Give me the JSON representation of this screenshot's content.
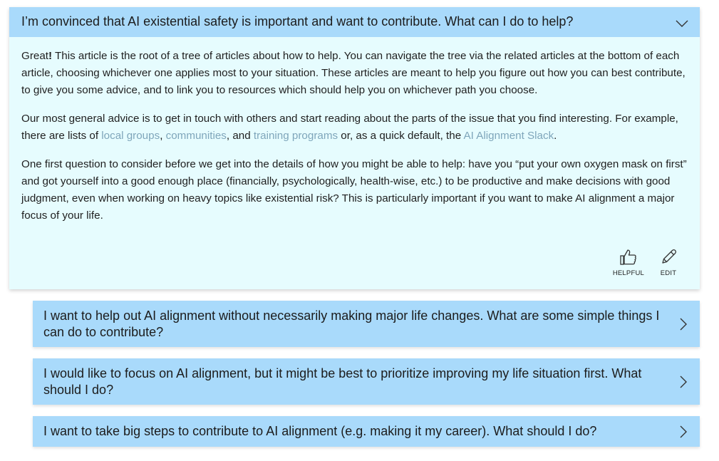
{
  "main": {
    "question": "I’m convinced that AI existential safety is important and want to contribute. What can I do to help?",
    "paragraphs": [
      {
        "segments": [
          {
            "text": "Great"
          },
          {
            "text": "!",
            "bold": true
          },
          {
            "text": " This article is the root of a tree of articles about how to help. You can navigate the tree via the related articles at the bottom of each article, choosing whichever one applies most to your situation. These articles are meant to help you figure out how you can best contribute, to give you some advice, and to link you to resources which should help you on whichever path you choose."
          }
        ]
      },
      {
        "segments": [
          {
            "text": "Our most general advice is to get in touch with others and start reading about the parts of the issue that you find interesting. For example, there are lists of "
          },
          {
            "text": "local groups",
            "link": true
          },
          {
            "text": ", "
          },
          {
            "text": "communities",
            "link": true
          },
          {
            "text": ", and "
          },
          {
            "text": "training programs",
            "link": true
          },
          {
            "text": " or, as a quick default, the "
          },
          {
            "text": "AI Alignment Slack",
            "link": true
          },
          {
            "text": "."
          }
        ]
      },
      {
        "segments": [
          {
            "text": "One first question to consider before we get into the details of how you might be able to help: have you “put your own oxygen mask on first” and got yourself into a good enough place (financially, psychologically, health-wise, etc.) to be productive and make decisions with good judgment, even when working on heavy topics like existential risk? This is particularly important if you want to make AI alignment a major focus of your life."
          }
        ]
      }
    ],
    "actions": {
      "helpful_label": "HELPFUL",
      "edit_label": "EDIT"
    },
    "header_icon": "chevron-down-icon"
  },
  "related": [
    {
      "question": "I want to help out AI alignment without necessarily making major life changes. What are some simple things I can do to contribute?",
      "icon": "chevron-right-icon"
    },
    {
      "question": "I would like to focus on AI alignment, but it might be best to prioritize improving my life situation first. What should I do?",
      "icon": "chevron-right-icon"
    },
    {
      "question": "I want to take big steps to contribute to AI alignment (e.g. making it my career). What should I do?",
      "icon": "chevron-right-icon"
    }
  ],
  "colors": {
    "header_bg": "#a9dafb",
    "card_bg": "#e6fcfe",
    "link": "#7fa6bb",
    "text": "#1f1f1f"
  }
}
